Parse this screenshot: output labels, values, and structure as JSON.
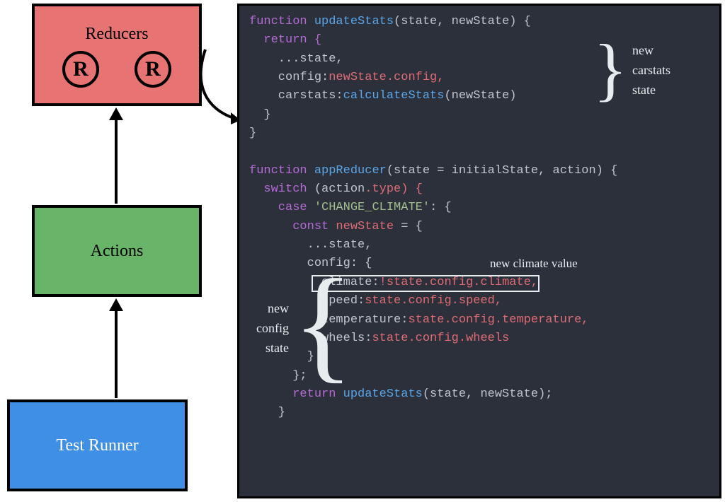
{
  "diagram": {
    "reducers": {
      "title": "Reducers",
      "icon": "R"
    },
    "actions": {
      "title": "Actions"
    },
    "runner": {
      "title": "Test Runner"
    }
  },
  "annotations": {
    "new_carstats_state_1": "new",
    "new_carstats_state_2": "carstats",
    "new_carstats_state_3": "state",
    "new_config_state_1": "new",
    "new_config_state_2": "config",
    "new_config_state_3": "state",
    "new_climate_value": "new climate value"
  },
  "code": {
    "l1_kw": "function",
    "l1_fn": "updateStats",
    "l1_args": "(state, newState) {",
    "l2": "  return {",
    "l3": "    ...state,",
    "l4a": "    config:",
    "l4b": "newState",
    "l4c": ".config,",
    "l5a": "    carstats:",
    "l5b": "calculateStats",
    "l5c": "(newState)",
    "l6": "  }",
    "l7": "}",
    "l8_kw": "function",
    "l8_fn": "appReducer",
    "l8_args": "(state = initialState, action) {",
    "l9a": "  switch",
    "l9b": " (action",
    "l9c": ".type) {",
    "l10a": "    case ",
    "l10b": "'CHANGE_CLIMATE'",
    "l10c": ": {",
    "l11a": "      const",
    "l11b": " newState",
    "l11c": " = {",
    "l12": "        ...state,",
    "l13": "        config: {",
    "l14a": "          climate:",
    "l14b": "!state",
    "l14c": ".config",
    "l14d": ".climate,",
    "l15a": "          speed:",
    "l15b": "state",
    "l15c": ".config",
    "l15d": ".speed,",
    "l16a": "          temperature:",
    "l16b": "state",
    "l16c": ".config",
    "l16d": ".temperature,",
    "l17a": "          wheels:",
    "l17b": "state",
    "l17c": ".config",
    "l17d": ".wheels",
    "l18": "        }",
    "l19": "      };",
    "l20a": "      return ",
    "l20b": "updateStats",
    "l20c": "(state, newState);",
    "l21": "    }"
  }
}
